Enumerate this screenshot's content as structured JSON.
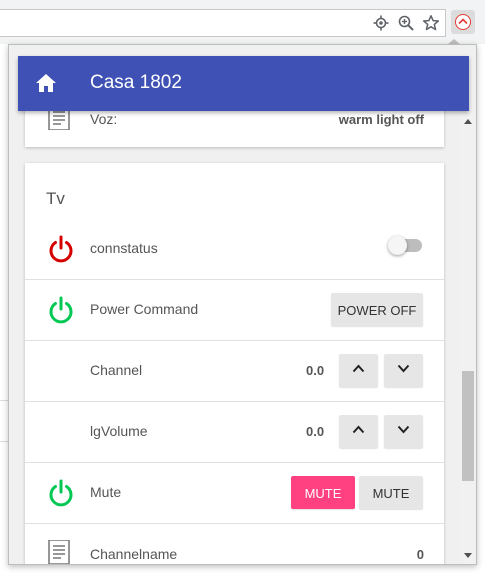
{
  "popup": {
    "title": "Casa 1802",
    "voice_card": {
      "label": "Voz:",
      "value": "warm light off"
    },
    "tv": {
      "section_title": "Tv",
      "connstatus": {
        "label": "connstatus",
        "toggle_on": false
      },
      "power_command": {
        "label": "Power Command",
        "button": "POWER OFF"
      },
      "channel": {
        "label": "Channel",
        "value": "0.0"
      },
      "lg_volume": {
        "label": "lgVolume",
        "value": "0.0"
      },
      "mute": {
        "label": "Mute",
        "button_active": "MUTE",
        "button_inactive": "MUTE"
      },
      "channelname": {
        "label": "Channelname",
        "value": "0"
      }
    }
  },
  "colors": {
    "header": "#3f51b5",
    "power_off": "#d50000",
    "power_on": "#00c853",
    "mute_active": "#ff4081"
  },
  "icons": [
    "location-icon",
    "zoom-icon",
    "bookmark-star-icon",
    "extension-icon",
    "home-icon",
    "document-icon",
    "power-icon",
    "chevron-up-icon",
    "chevron-down-icon"
  ]
}
